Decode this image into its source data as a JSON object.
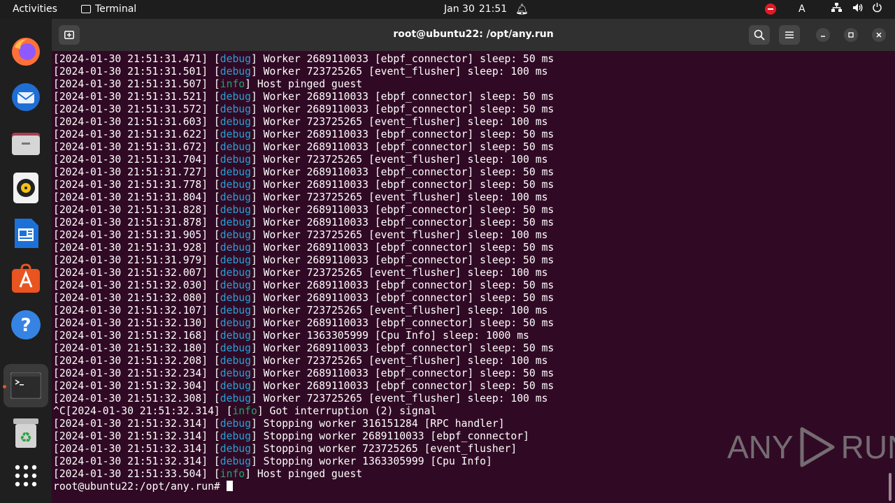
{
  "topbar": {
    "activities": "Activities",
    "app_name": "Terminal",
    "date": "Jan 30",
    "time": "21:51",
    "input_indicator": "A"
  },
  "dock": {
    "items": [
      "firefox-icon",
      "thunderbird-icon",
      "files-icon",
      "rhythmbox-icon",
      "writer-icon",
      "software-icon",
      "help-icon",
      "terminal-icon",
      "trash-icon",
      "apps-grid-icon"
    ]
  },
  "window": {
    "title": "root@ubuntu22: /opt/any.run"
  },
  "terminal": {
    "lines": [
      {
        "pre": "[2024-01-30 21:51:31.471] [",
        "lvl": "debug",
        "post": "] Worker 2689110033 [ebpf_connector] sleep: 50 ms"
      },
      {
        "pre": "[2024-01-30 21:51:31.501] [",
        "lvl": "debug",
        "post": "] Worker 723725265 [event_flusher] sleep: 100 ms"
      },
      {
        "pre": "[2024-01-30 21:51:31.507] [",
        "lvl": "info",
        "post": "] Host pinged guest"
      },
      {
        "pre": "[2024-01-30 21:51:31.521] [",
        "lvl": "debug",
        "post": "] Worker 2689110033 [ebpf_connector] sleep: 50 ms"
      },
      {
        "pre": "[2024-01-30 21:51:31.572] [",
        "lvl": "debug",
        "post": "] Worker 2689110033 [ebpf_connector] sleep: 50 ms"
      },
      {
        "pre": "[2024-01-30 21:51:31.603] [",
        "lvl": "debug",
        "post": "] Worker 723725265 [event_flusher] sleep: 100 ms"
      },
      {
        "pre": "[2024-01-30 21:51:31.622] [",
        "lvl": "debug",
        "post": "] Worker 2689110033 [ebpf_connector] sleep: 50 ms"
      },
      {
        "pre": "[2024-01-30 21:51:31.672] [",
        "lvl": "debug",
        "post": "] Worker 2689110033 [ebpf_connector] sleep: 50 ms"
      },
      {
        "pre": "[2024-01-30 21:51:31.704] [",
        "lvl": "debug",
        "post": "] Worker 723725265 [event_flusher] sleep: 100 ms"
      },
      {
        "pre": "[2024-01-30 21:51:31.727] [",
        "lvl": "debug",
        "post": "] Worker 2689110033 [ebpf_connector] sleep: 50 ms"
      },
      {
        "pre": "[2024-01-30 21:51:31.778] [",
        "lvl": "debug",
        "post": "] Worker 2689110033 [ebpf_connector] sleep: 50 ms"
      },
      {
        "pre": "[2024-01-30 21:51:31.804] [",
        "lvl": "debug",
        "post": "] Worker 723725265 [event_flusher] sleep: 100 ms"
      },
      {
        "pre": "[2024-01-30 21:51:31.828] [",
        "lvl": "debug",
        "post": "] Worker 2689110033 [ebpf_connector] sleep: 50 ms"
      },
      {
        "pre": "[2024-01-30 21:51:31.878] [",
        "lvl": "debug",
        "post": "] Worker 2689110033 [ebpf_connector] sleep: 50 ms"
      },
      {
        "pre": "[2024-01-30 21:51:31.905] [",
        "lvl": "debug",
        "post": "] Worker 723725265 [event_flusher] sleep: 100 ms"
      },
      {
        "pre": "[2024-01-30 21:51:31.928] [",
        "lvl": "debug",
        "post": "] Worker 2689110033 [ebpf_connector] sleep: 50 ms"
      },
      {
        "pre": "[2024-01-30 21:51:31.979] [",
        "lvl": "debug",
        "post": "] Worker 2689110033 [ebpf_connector] sleep: 50 ms"
      },
      {
        "pre": "[2024-01-30 21:51:32.007] [",
        "lvl": "debug",
        "post": "] Worker 723725265 [event_flusher] sleep: 100 ms"
      },
      {
        "pre": "[2024-01-30 21:51:32.030] [",
        "lvl": "debug",
        "post": "] Worker 2689110033 [ebpf_connector] sleep: 50 ms"
      },
      {
        "pre": "[2024-01-30 21:51:32.080] [",
        "lvl": "debug",
        "post": "] Worker 2689110033 [ebpf_connector] sleep: 50 ms"
      },
      {
        "pre": "[2024-01-30 21:51:32.107] [",
        "lvl": "debug",
        "post": "] Worker 723725265 [event_flusher] sleep: 100 ms"
      },
      {
        "pre": "[2024-01-30 21:51:32.130] [",
        "lvl": "debug",
        "post": "] Worker 2689110033 [ebpf_connector] sleep: 50 ms"
      },
      {
        "pre": "[2024-01-30 21:51:32.168] [",
        "lvl": "debug",
        "post": "] Worker 1363305999 [Cpu Info] sleep: 1000 ms"
      },
      {
        "pre": "[2024-01-30 21:51:32.180] [",
        "lvl": "debug",
        "post": "] Worker 2689110033 [ebpf_connector] sleep: 50 ms"
      },
      {
        "pre": "[2024-01-30 21:51:32.208] [",
        "lvl": "debug",
        "post": "] Worker 723725265 [event_flusher] sleep: 100 ms"
      },
      {
        "pre": "[2024-01-30 21:51:32.234] [",
        "lvl": "debug",
        "post": "] Worker 2689110033 [ebpf_connector] sleep: 50 ms"
      },
      {
        "pre": "[2024-01-30 21:51:32.304] [",
        "lvl": "debug",
        "post": "] Worker 2689110033 [ebpf_connector] sleep: 50 ms"
      },
      {
        "pre": "[2024-01-30 21:51:32.308] [",
        "lvl": "debug",
        "post": "] Worker 723725265 [event_flusher] sleep: 100 ms"
      },
      {
        "pre": "^C[2024-01-30 21:51:32.314] [",
        "lvl": "info",
        "post": "] Got interruption (2) signal"
      },
      {
        "pre": "[2024-01-30 21:51:32.314] [",
        "lvl": "debug",
        "post": "] Stopping worker 316151284 [RPC handler]"
      },
      {
        "pre": "[2024-01-30 21:51:32.314] [",
        "lvl": "debug",
        "post": "] Stopping worker 2689110033 [ebpf_connector]"
      },
      {
        "pre": "[2024-01-30 21:51:32.314] [",
        "lvl": "debug",
        "post": "] Stopping worker 723725265 [event_flusher]"
      },
      {
        "pre": "[2024-01-30 21:51:32.314] [",
        "lvl": "debug",
        "post": "] Stopping worker 1363305999 [Cpu Info]"
      },
      {
        "pre": "[2024-01-30 21:51:33.504] [",
        "lvl": "info",
        "post": "] Host pinged guest"
      }
    ],
    "prompt": "root@ubuntu22:/opt/any.run# "
  },
  "watermark": {
    "left": "ANY",
    "right": "RUN"
  }
}
